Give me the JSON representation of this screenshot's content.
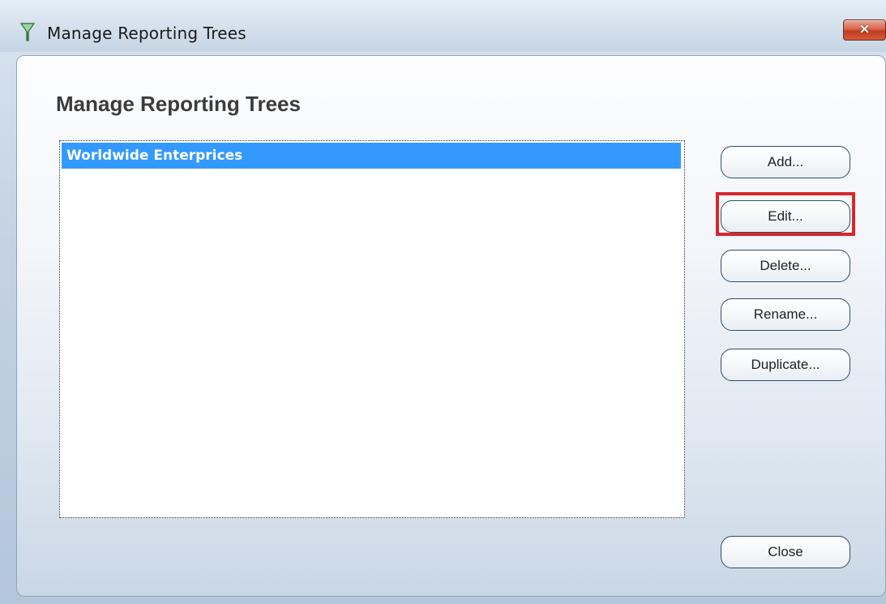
{
  "window": {
    "title": "Manage Reporting Trees",
    "close_glyph": "×",
    "icon": "funnel-icon"
  },
  "dialog": {
    "heading": "Manage Reporting Trees"
  },
  "tree_list": {
    "items": [
      {
        "label": "Worldwide Enterprices",
        "selected": true
      }
    ]
  },
  "buttons": {
    "add": "Add...",
    "edit": "Edit...",
    "delete": "Delete...",
    "rename": "Rename...",
    "duplicate": "Duplicate...",
    "close": "Close"
  },
  "annotation": {
    "highlighted_control": "edit",
    "color": "#d8262c"
  },
  "colors": {
    "selection": "#3399ff",
    "close_button": "#c23b1f"
  }
}
